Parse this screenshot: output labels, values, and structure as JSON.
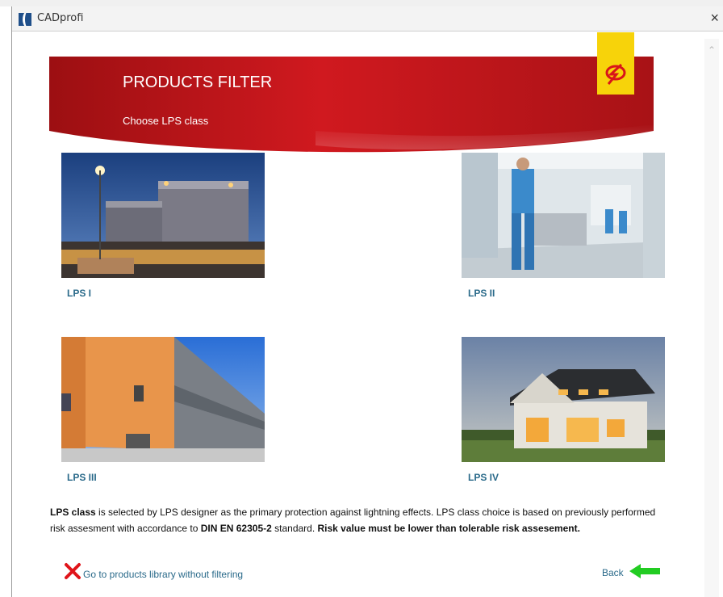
{
  "window": {
    "title": "CADprofi",
    "close_glyph": "×",
    "app_icon": "cadprofi-icon"
  },
  "banner": {
    "title": "PRODUCTS FILTER",
    "subtitle": "Choose LPS class",
    "logo_icon": "lightning-protection-logo-icon"
  },
  "tiles": [
    {
      "label": "LPS I"
    },
    {
      "label": "LPS II"
    },
    {
      "label": "LPS III"
    },
    {
      "label": "LPS IV"
    }
  ],
  "description": {
    "part1_bold": "LPS class",
    "part2": " is selected by LPS designer as the primary protection against lightning effects. LPS class choice is based on previously performed risk assesment with accordance to ",
    "part3_bold": "DIN EN 62305-2",
    "part4": " standard. ",
    "part5_bold": "Risk value must be lower than tolerable risk assesement."
  },
  "links": {
    "no_filter": "Go to products library without filtering",
    "back": "Back"
  },
  "colors": {
    "banner_red": "#c8161d",
    "link_blue": "#2a6a8a",
    "logo_yellow": "#f7d30a",
    "arrow_green": "#22cc22"
  }
}
